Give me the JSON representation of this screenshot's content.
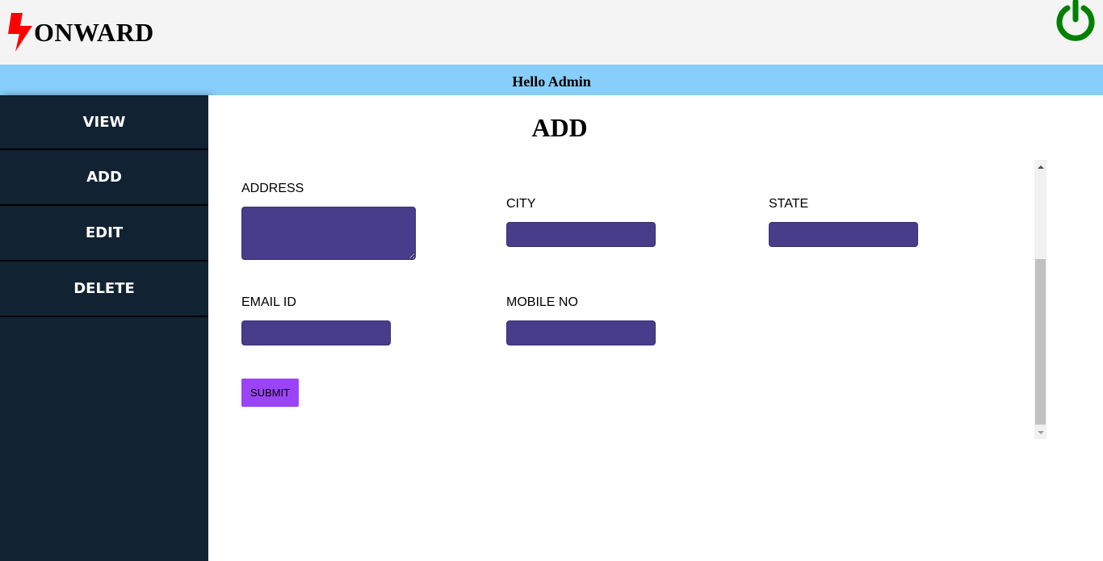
{
  "header": {
    "logo_text": "ONWARD",
    "logo_icon": "lightning-bolt-icon",
    "power_icon": "power-icon",
    "power_color": "#008000"
  },
  "greeting": "Hello Admin",
  "sidebar": {
    "items": [
      {
        "label": "VIEW"
      },
      {
        "label": "ADD"
      },
      {
        "label": "EDIT"
      },
      {
        "label": "DELETE"
      }
    ]
  },
  "page": {
    "title": "ADD"
  },
  "form": {
    "address_label": "ADDRESS",
    "address_value": "",
    "city_label": "CITY",
    "city_value": "",
    "state_label": "STATE",
    "state_value": "",
    "email_label": "EMAIL ID",
    "email_value": "",
    "mobile_label": "MOBILE NO",
    "mobile_value": "",
    "submit_label": "SUBMIT"
  },
  "colors": {
    "header_bg": "#f4f4f4",
    "greeting_bg": "#87cefa",
    "sidebar_bg": "#112233",
    "field_bg": "#483d8b",
    "submit_bg": "#9b44f7",
    "logo_bolt": "#ff0000"
  }
}
